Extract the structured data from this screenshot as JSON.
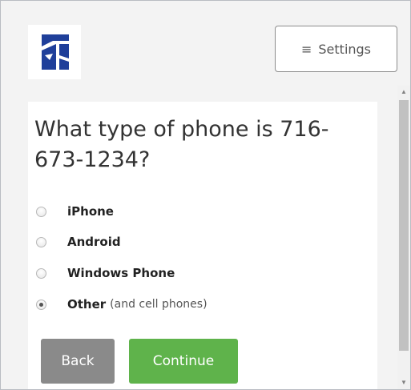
{
  "header": {
    "settings_label": "Settings"
  },
  "question": {
    "text": "What type of phone is 716-673-1234?"
  },
  "options": [
    {
      "label": "iPhone",
      "suffix": "",
      "checked": false
    },
    {
      "label": "Android",
      "suffix": "",
      "checked": false
    },
    {
      "label": "Windows Phone",
      "suffix": "",
      "checked": false
    },
    {
      "label": "Other",
      "suffix": "(and cell phones)",
      "checked": true
    }
  ],
  "buttons": {
    "back_label": "Back",
    "continue_label": "Continue"
  },
  "colors": {
    "logo_blue": "#1f3f9a",
    "continue_green": "#5fb34b",
    "back_gray": "#8a8a8a"
  }
}
